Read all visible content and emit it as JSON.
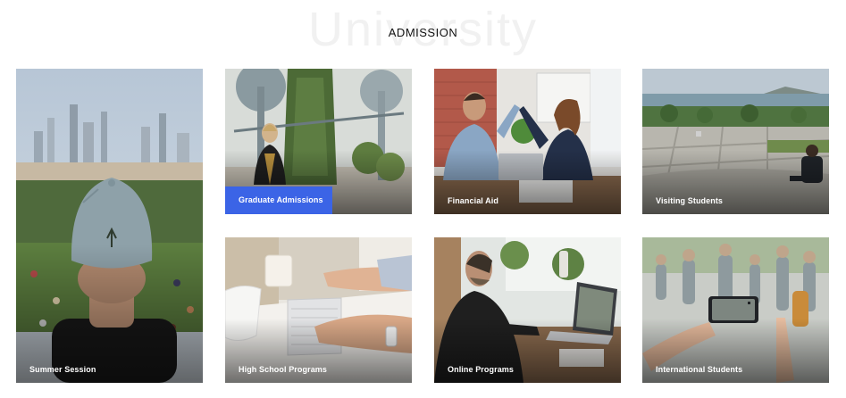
{
  "watermark": "University",
  "heading": "ADMISSION",
  "tiles": {
    "summer": {
      "label": "Summer Session"
    },
    "graduate": {
      "label": "Graduate Admissions"
    },
    "financial": {
      "label": "Financial Aid"
    },
    "visiting": {
      "label": "Visiting Students"
    },
    "highschool": {
      "label": "High School Programs"
    },
    "online": {
      "label": "Online Programs"
    },
    "international": {
      "label": "International Students"
    }
  },
  "colors": {
    "accent": "#3b64e6",
    "heading": "#111111",
    "watermark": "#f1f1f1"
  }
}
